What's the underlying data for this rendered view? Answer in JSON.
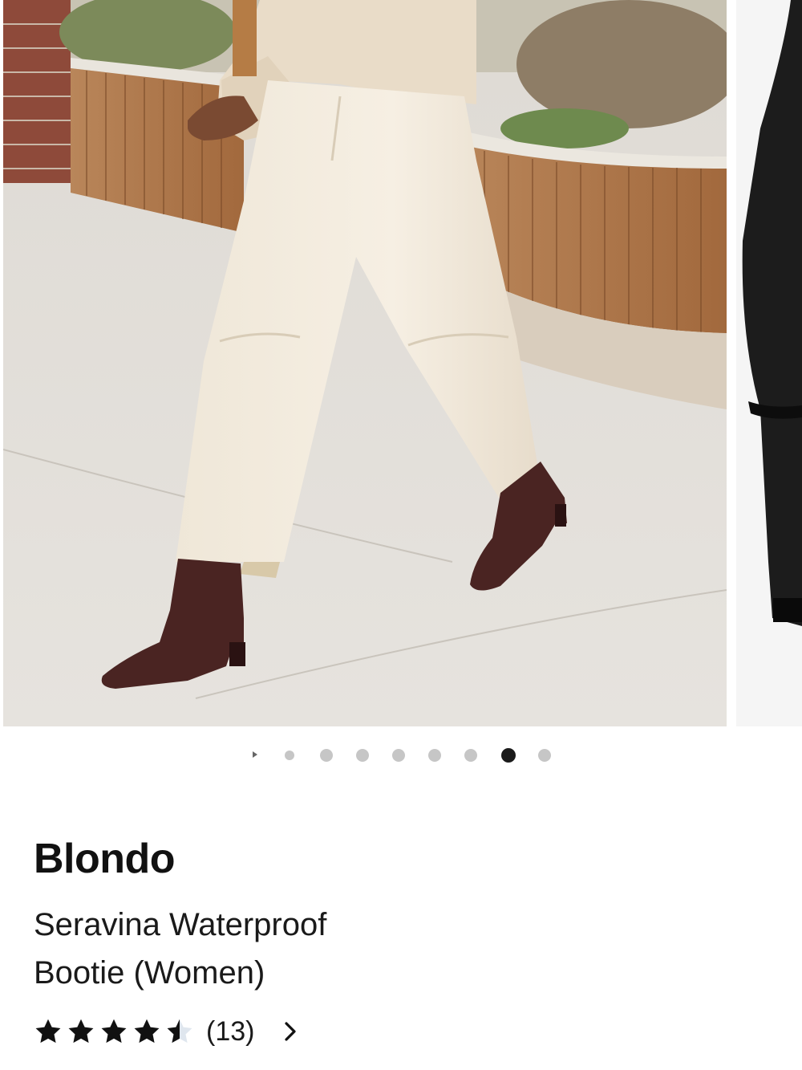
{
  "carousel": {
    "total_slides": 8,
    "active_index": 7,
    "main_image": "woman walking in cream trousers and dark brown suede ankle boots",
    "next_image": "black suede boot detail"
  },
  "product": {
    "brand": "Blondo",
    "name": "Seravina Waterproof Bootie (Women)",
    "rating": 4.5,
    "rating_max": 5,
    "review_count_label": "(13)"
  },
  "icons": {
    "slide_arrow": "play-arrow-icon",
    "star": "star-icon",
    "half_star": "half-star-icon",
    "chevron": "chevron-right-icon"
  },
  "colors": {
    "active_dot": "#1a1a1a",
    "inactive_dot": "#c6c6c6",
    "star": "#111111"
  }
}
